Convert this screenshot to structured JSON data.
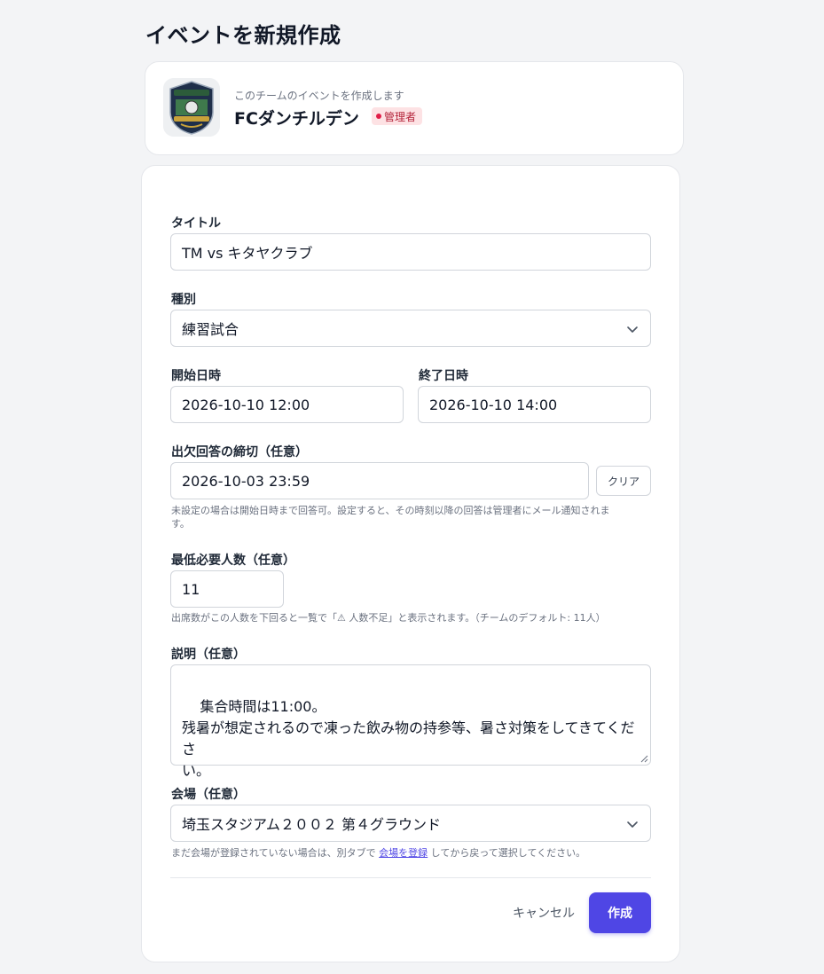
{
  "page": {
    "title": "イベントを新規作成"
  },
  "team": {
    "subtitle": "このチームのイベントを作成します",
    "name": "FCダンチルデン",
    "role_badge": "管理者",
    "badge_color": "#e11d48",
    "logo_text_top": "FC DANCHILDEN",
    "logo_text_mid": "FC DANCHILDEN"
  },
  "form": {
    "title": {
      "label": "タイトル",
      "value": "TM vs キタヤクラブ"
    },
    "type": {
      "label": "種別",
      "value": "練習試合",
      "icon": "chevron-down-icon"
    },
    "start": {
      "label": "開始日時",
      "value": "2026-10-10 12:00"
    },
    "end": {
      "label": "終了日時",
      "value": "2026-10-10 14:00"
    },
    "deadline": {
      "label": "出欠回答の締切（任意）",
      "value": "2026-10-03 23:59",
      "clear_label": "クリア",
      "hint_line1": "未設定の場合は開始日時まで回答可。設定すると、その時刻以降の回答は管理者にメール通知されま",
      "hint_line2": "す。"
    },
    "min_people": {
      "label": "最低必要人数（任意）",
      "value": "11",
      "hint": "出席数がこの人数を下回ると一覧で「⚠ 人数不足」と表示されます。（チームのデフォルト: 11人）"
    },
    "description": {
      "label": "説明（任意）",
      "value": "集合時間は11:00。\n残暑が想定されるので凍った飲み物の持参等、暑さ対策をしてきてくださ\nい。"
    },
    "venue": {
      "label": "会場（任意）",
      "value": "埼玉スタジアム２００２ 第４グラウンド",
      "icon": "chevron-down-icon",
      "hint_before": "まだ会場が登録されていない場合は、別タブで ",
      "hint_link": "会場を登録",
      "hint_after": " してから戻って選択してください。"
    }
  },
  "actions": {
    "cancel_label": "キャンセル",
    "submit_label": "作成",
    "accent_color": "#4f46e5"
  }
}
